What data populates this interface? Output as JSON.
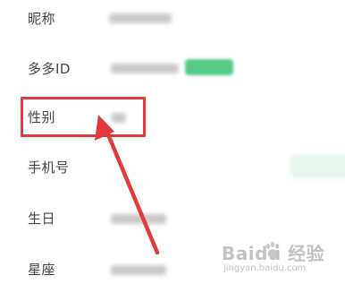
{
  "profile": {
    "rows": [
      {
        "id": "nickname",
        "label": "昵称"
      },
      {
        "id": "pdd-id",
        "label": "多多ID"
      },
      {
        "id": "gender",
        "label": "性别"
      },
      {
        "id": "phone",
        "label": "手机号"
      },
      {
        "id": "birthday",
        "label": "生日"
      },
      {
        "id": "constellation",
        "label": "星座"
      }
    ]
  },
  "annotation": {
    "highlight_color": "#e23b3b",
    "highlighted_row": "gender"
  },
  "watermark": {
    "brand": "Baidu 经验",
    "url": "jingyan.baidu.com"
  },
  "colors": {
    "label": "#444444",
    "blurred_value": "#c9c9c9",
    "copy_badge": "#57c98a",
    "bind_button_bg": "#e6f6ec"
  }
}
